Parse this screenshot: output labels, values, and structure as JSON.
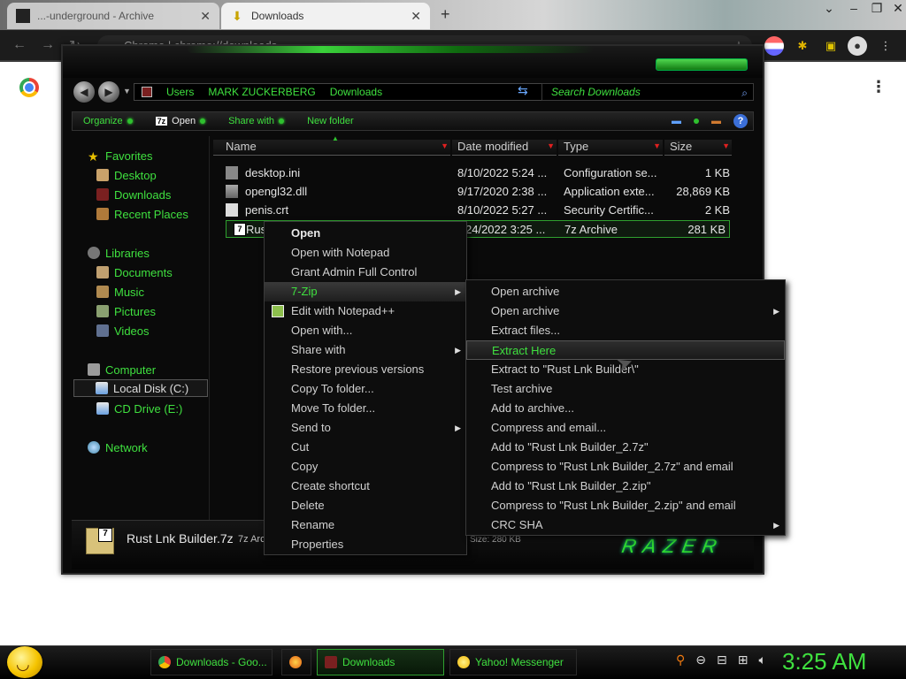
{
  "browser": {
    "tabs": [
      {
        "label": "...-underground - Archive"
      },
      {
        "label": "Downloads"
      }
    ],
    "new_tab": "+",
    "omnibox": "Chrome  |  chrome://downloads",
    "menu_glyph": "⋮"
  },
  "explorer": {
    "breadcrumb": [
      "Users",
      "MARK ZUCKERBERG",
      "Downloads"
    ],
    "search_placeholder": "Search Downloads",
    "commands": [
      {
        "label": "Organize"
      },
      {
        "label": "Open"
      },
      {
        "label": "Share with"
      },
      {
        "label": "New folder"
      }
    ],
    "nav": {
      "favorites": "Favorites",
      "desktop": "Desktop",
      "downloads": "Downloads",
      "recent_places": "Recent Places",
      "libraries": "Libraries",
      "documents": "Documents",
      "music": "Music",
      "pictures": "Pictures",
      "videos": "Videos",
      "computer": "Computer",
      "local_disk": "Local Disk (C:)",
      "cd_drive": "CD Drive (E:)",
      "network": "Network"
    },
    "columns": {
      "name": "Name",
      "date": "Date modified",
      "type": "Type",
      "size": "Size"
    },
    "files": [
      {
        "name": "desktop.ini",
        "date": "8/10/2022 5:24 ...",
        "type": "Configuration se...",
        "size": "1 KB"
      },
      {
        "name": "opengl32.dll",
        "date": "9/17/2020 2:38 ...",
        "type": "Application exte...",
        "size": "28,869 KB"
      },
      {
        "name": "penis.crt",
        "date": "8/10/2022 5:27 ...",
        "type": "Security Certific...",
        "size": "2 KB"
      },
      {
        "name": "Rust",
        "date": "24/2022 3:25 ...",
        "type": "7z Archive",
        "size": "281 KB"
      }
    ],
    "details": {
      "name": "Rust Lnk Builder.7z",
      "type": "7z Arc",
      "size": "Size: 280 KB",
      "brand": "RAZER"
    }
  },
  "context_menu": {
    "items": [
      "Open",
      "Open with Notepad",
      "Grant Admin Full Control",
      "7-Zip",
      "Edit with Notepad++",
      "Open with...",
      "Share with",
      "Restore previous versions",
      "Copy To folder...",
      "Move To folder...",
      "Send to",
      "Cut",
      "Copy",
      "Create shortcut",
      "Delete",
      "Rename",
      "Properties"
    ]
  },
  "submenu_7zip": {
    "items": [
      "Open archive",
      "Open archive",
      "Extract files...",
      "Extract Here",
      "Extract to \"Rust Lnk Builder\\\"",
      "Test archive",
      "Add to archive...",
      "Compress and email...",
      "Add to \"Rust Lnk Builder_2.7z\"",
      "Compress to \"Rust Lnk Builder_2.7z\" and email",
      "Add to \"Rust Lnk Builder_2.zip\"",
      "Compress to \"Rust Lnk Builder_2.zip\" and email",
      "CRC SHA"
    ]
  },
  "taskbar": {
    "buttons": [
      {
        "label": "Downloads - Goo..."
      },
      {
        "label": "Downloads"
      },
      {
        "label": "Yahoo! Messenger"
      }
    ],
    "clock": "3:25 AM"
  },
  "colors": {
    "accent_green": "#3fe03f",
    "highlight_border": "#2fa02f"
  }
}
